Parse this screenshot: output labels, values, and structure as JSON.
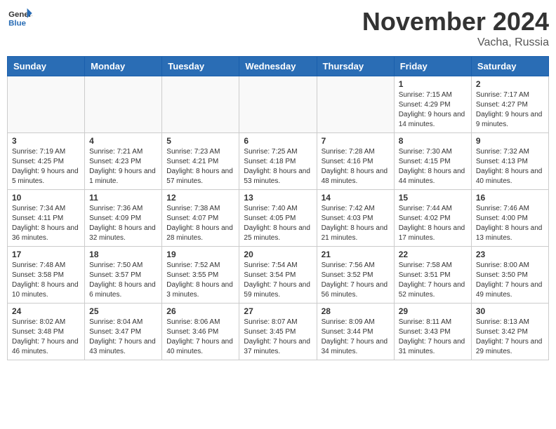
{
  "logo": {
    "text_general": "General",
    "text_blue": "Blue"
  },
  "title": "November 2024",
  "location": "Vacha, Russia",
  "days_of_week": [
    "Sunday",
    "Monday",
    "Tuesday",
    "Wednesday",
    "Thursday",
    "Friday",
    "Saturday"
  ],
  "weeks": [
    [
      {
        "day": "",
        "info": ""
      },
      {
        "day": "",
        "info": ""
      },
      {
        "day": "",
        "info": ""
      },
      {
        "day": "",
        "info": ""
      },
      {
        "day": "",
        "info": ""
      },
      {
        "day": "1",
        "info": "Sunrise: 7:15 AM\nSunset: 4:29 PM\nDaylight: 9 hours and 14 minutes."
      },
      {
        "day": "2",
        "info": "Sunrise: 7:17 AM\nSunset: 4:27 PM\nDaylight: 9 hours and 9 minutes."
      }
    ],
    [
      {
        "day": "3",
        "info": "Sunrise: 7:19 AM\nSunset: 4:25 PM\nDaylight: 9 hours and 5 minutes."
      },
      {
        "day": "4",
        "info": "Sunrise: 7:21 AM\nSunset: 4:23 PM\nDaylight: 9 hours and 1 minute."
      },
      {
        "day": "5",
        "info": "Sunrise: 7:23 AM\nSunset: 4:21 PM\nDaylight: 8 hours and 57 minutes."
      },
      {
        "day": "6",
        "info": "Sunrise: 7:25 AM\nSunset: 4:18 PM\nDaylight: 8 hours and 53 minutes."
      },
      {
        "day": "7",
        "info": "Sunrise: 7:28 AM\nSunset: 4:16 PM\nDaylight: 8 hours and 48 minutes."
      },
      {
        "day": "8",
        "info": "Sunrise: 7:30 AM\nSunset: 4:15 PM\nDaylight: 8 hours and 44 minutes."
      },
      {
        "day": "9",
        "info": "Sunrise: 7:32 AM\nSunset: 4:13 PM\nDaylight: 8 hours and 40 minutes."
      }
    ],
    [
      {
        "day": "10",
        "info": "Sunrise: 7:34 AM\nSunset: 4:11 PM\nDaylight: 8 hours and 36 minutes."
      },
      {
        "day": "11",
        "info": "Sunrise: 7:36 AM\nSunset: 4:09 PM\nDaylight: 8 hours and 32 minutes."
      },
      {
        "day": "12",
        "info": "Sunrise: 7:38 AM\nSunset: 4:07 PM\nDaylight: 8 hours and 28 minutes."
      },
      {
        "day": "13",
        "info": "Sunrise: 7:40 AM\nSunset: 4:05 PM\nDaylight: 8 hours and 25 minutes."
      },
      {
        "day": "14",
        "info": "Sunrise: 7:42 AM\nSunset: 4:03 PM\nDaylight: 8 hours and 21 minutes."
      },
      {
        "day": "15",
        "info": "Sunrise: 7:44 AM\nSunset: 4:02 PM\nDaylight: 8 hours and 17 minutes."
      },
      {
        "day": "16",
        "info": "Sunrise: 7:46 AM\nSunset: 4:00 PM\nDaylight: 8 hours and 13 minutes."
      }
    ],
    [
      {
        "day": "17",
        "info": "Sunrise: 7:48 AM\nSunset: 3:58 PM\nDaylight: 8 hours and 10 minutes."
      },
      {
        "day": "18",
        "info": "Sunrise: 7:50 AM\nSunset: 3:57 PM\nDaylight: 8 hours and 6 minutes."
      },
      {
        "day": "19",
        "info": "Sunrise: 7:52 AM\nSunset: 3:55 PM\nDaylight: 8 hours and 3 minutes."
      },
      {
        "day": "20",
        "info": "Sunrise: 7:54 AM\nSunset: 3:54 PM\nDaylight: 7 hours and 59 minutes."
      },
      {
        "day": "21",
        "info": "Sunrise: 7:56 AM\nSunset: 3:52 PM\nDaylight: 7 hours and 56 minutes."
      },
      {
        "day": "22",
        "info": "Sunrise: 7:58 AM\nSunset: 3:51 PM\nDaylight: 7 hours and 52 minutes."
      },
      {
        "day": "23",
        "info": "Sunrise: 8:00 AM\nSunset: 3:50 PM\nDaylight: 7 hours and 49 minutes."
      }
    ],
    [
      {
        "day": "24",
        "info": "Sunrise: 8:02 AM\nSunset: 3:48 PM\nDaylight: 7 hours and 46 minutes."
      },
      {
        "day": "25",
        "info": "Sunrise: 8:04 AM\nSunset: 3:47 PM\nDaylight: 7 hours and 43 minutes."
      },
      {
        "day": "26",
        "info": "Sunrise: 8:06 AM\nSunset: 3:46 PM\nDaylight: 7 hours and 40 minutes."
      },
      {
        "day": "27",
        "info": "Sunrise: 8:07 AM\nSunset: 3:45 PM\nDaylight: 7 hours and 37 minutes."
      },
      {
        "day": "28",
        "info": "Sunrise: 8:09 AM\nSunset: 3:44 PM\nDaylight: 7 hours and 34 minutes."
      },
      {
        "day": "29",
        "info": "Sunrise: 8:11 AM\nSunset: 3:43 PM\nDaylight: 7 hours and 31 minutes."
      },
      {
        "day": "30",
        "info": "Sunrise: 8:13 AM\nSunset: 3:42 PM\nDaylight: 7 hours and 29 minutes."
      }
    ]
  ]
}
